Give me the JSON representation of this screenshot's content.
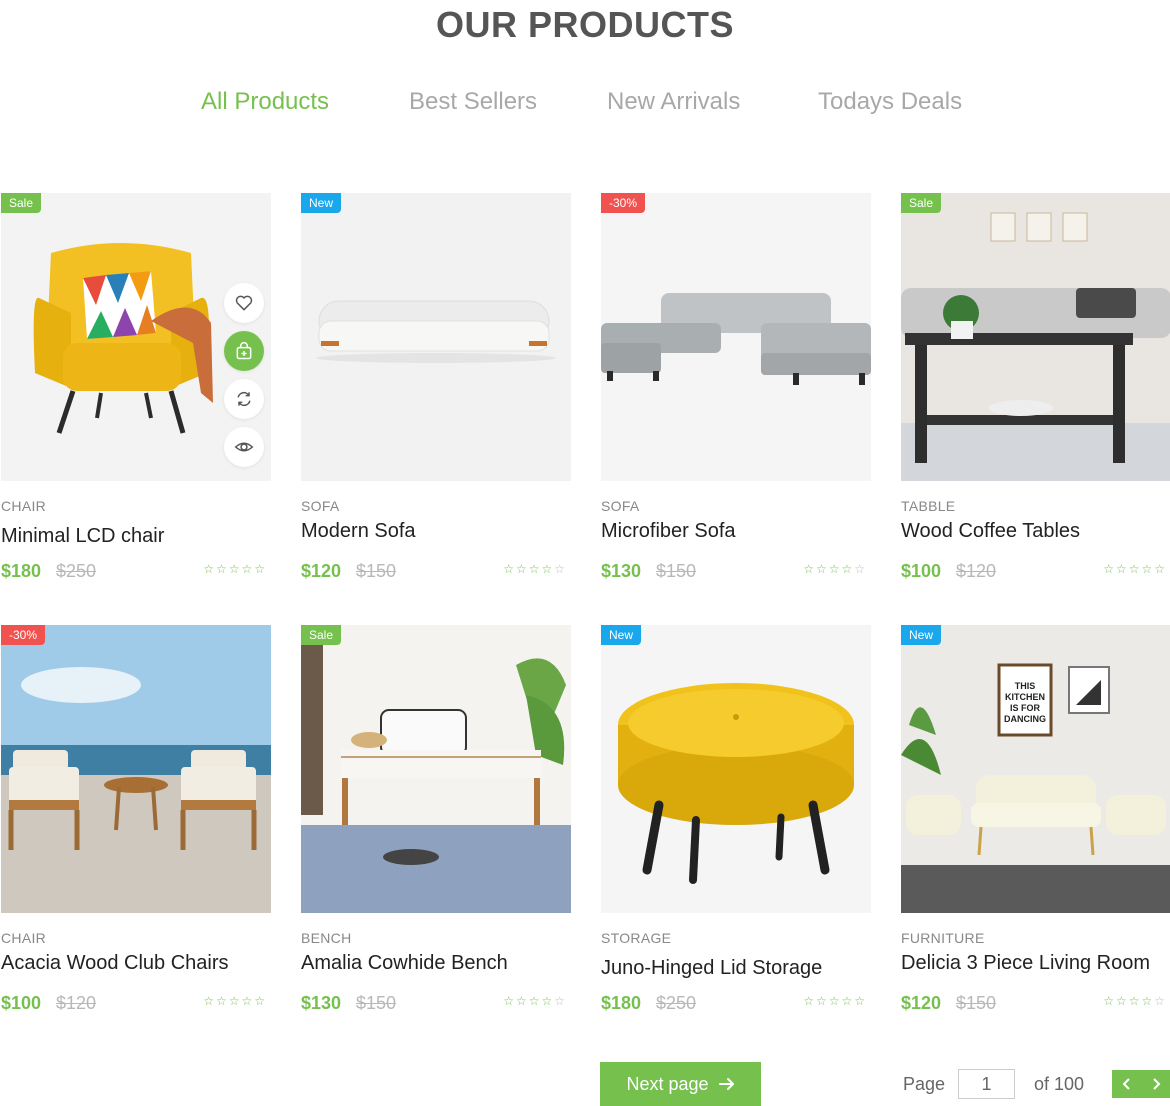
{
  "header": {
    "title": "OUR PRODUCTS"
  },
  "tabs": [
    {
      "label": "All Products",
      "active": true
    },
    {
      "label": "Best Sellers",
      "active": false
    },
    {
      "label": "New Arrivals",
      "active": false
    },
    {
      "label": "Todays Deals",
      "active": false
    }
  ],
  "colors": {
    "accent": "#76c14e",
    "new_badge": "#1aa7ec",
    "discount_badge": "#f0524f"
  },
  "product_actions": [
    "heart-icon",
    "add-to-cart-icon",
    "compare-icon",
    "quick-view-icon"
  ],
  "products": [
    {
      "badge": "Sale",
      "category": "CHAIR",
      "name": "Minimal LCD chair",
      "price": "$180",
      "old_price": "$250",
      "rating": 5
    },
    {
      "badge": "New",
      "category": "SOFA",
      "name": "Modern Sofa",
      "price": "$120",
      "old_price": "$150",
      "rating": 4
    },
    {
      "badge": "-30%",
      "category": "SOFA",
      "name": "Microfiber Sofa",
      "price": "$130",
      "old_price": "$150",
      "rating": 4
    },
    {
      "badge": "Sale",
      "category": "TABBLE",
      "name": "Wood Coffee Tables",
      "price": "$100",
      "old_price": "$120",
      "rating": 5
    },
    {
      "badge": "-30%",
      "category": "CHAIR",
      "name": "Acacia Wood Club Chairs",
      "price": "$100",
      "old_price": "$120",
      "rating": 5
    },
    {
      "badge": "Sale",
      "category": "BENCH",
      "name": "Amalia Cowhide Bench",
      "price": "$130",
      "old_price": "$150",
      "rating": 4
    },
    {
      "badge": "New",
      "category": "STORAGE",
      "name": "Juno-Hinged Lid Storage",
      "price": "$180",
      "old_price": "$250",
      "rating": 5
    },
    {
      "badge": "New",
      "category": "FURNITURE",
      "name": "Delicia 3 Piece Living Room",
      "price": "$120",
      "old_price": "$150",
      "rating": 4
    }
  ],
  "pagination": {
    "next_label": "Next page",
    "page_label": "Page",
    "current_page": "1",
    "of_label": "of 100"
  }
}
